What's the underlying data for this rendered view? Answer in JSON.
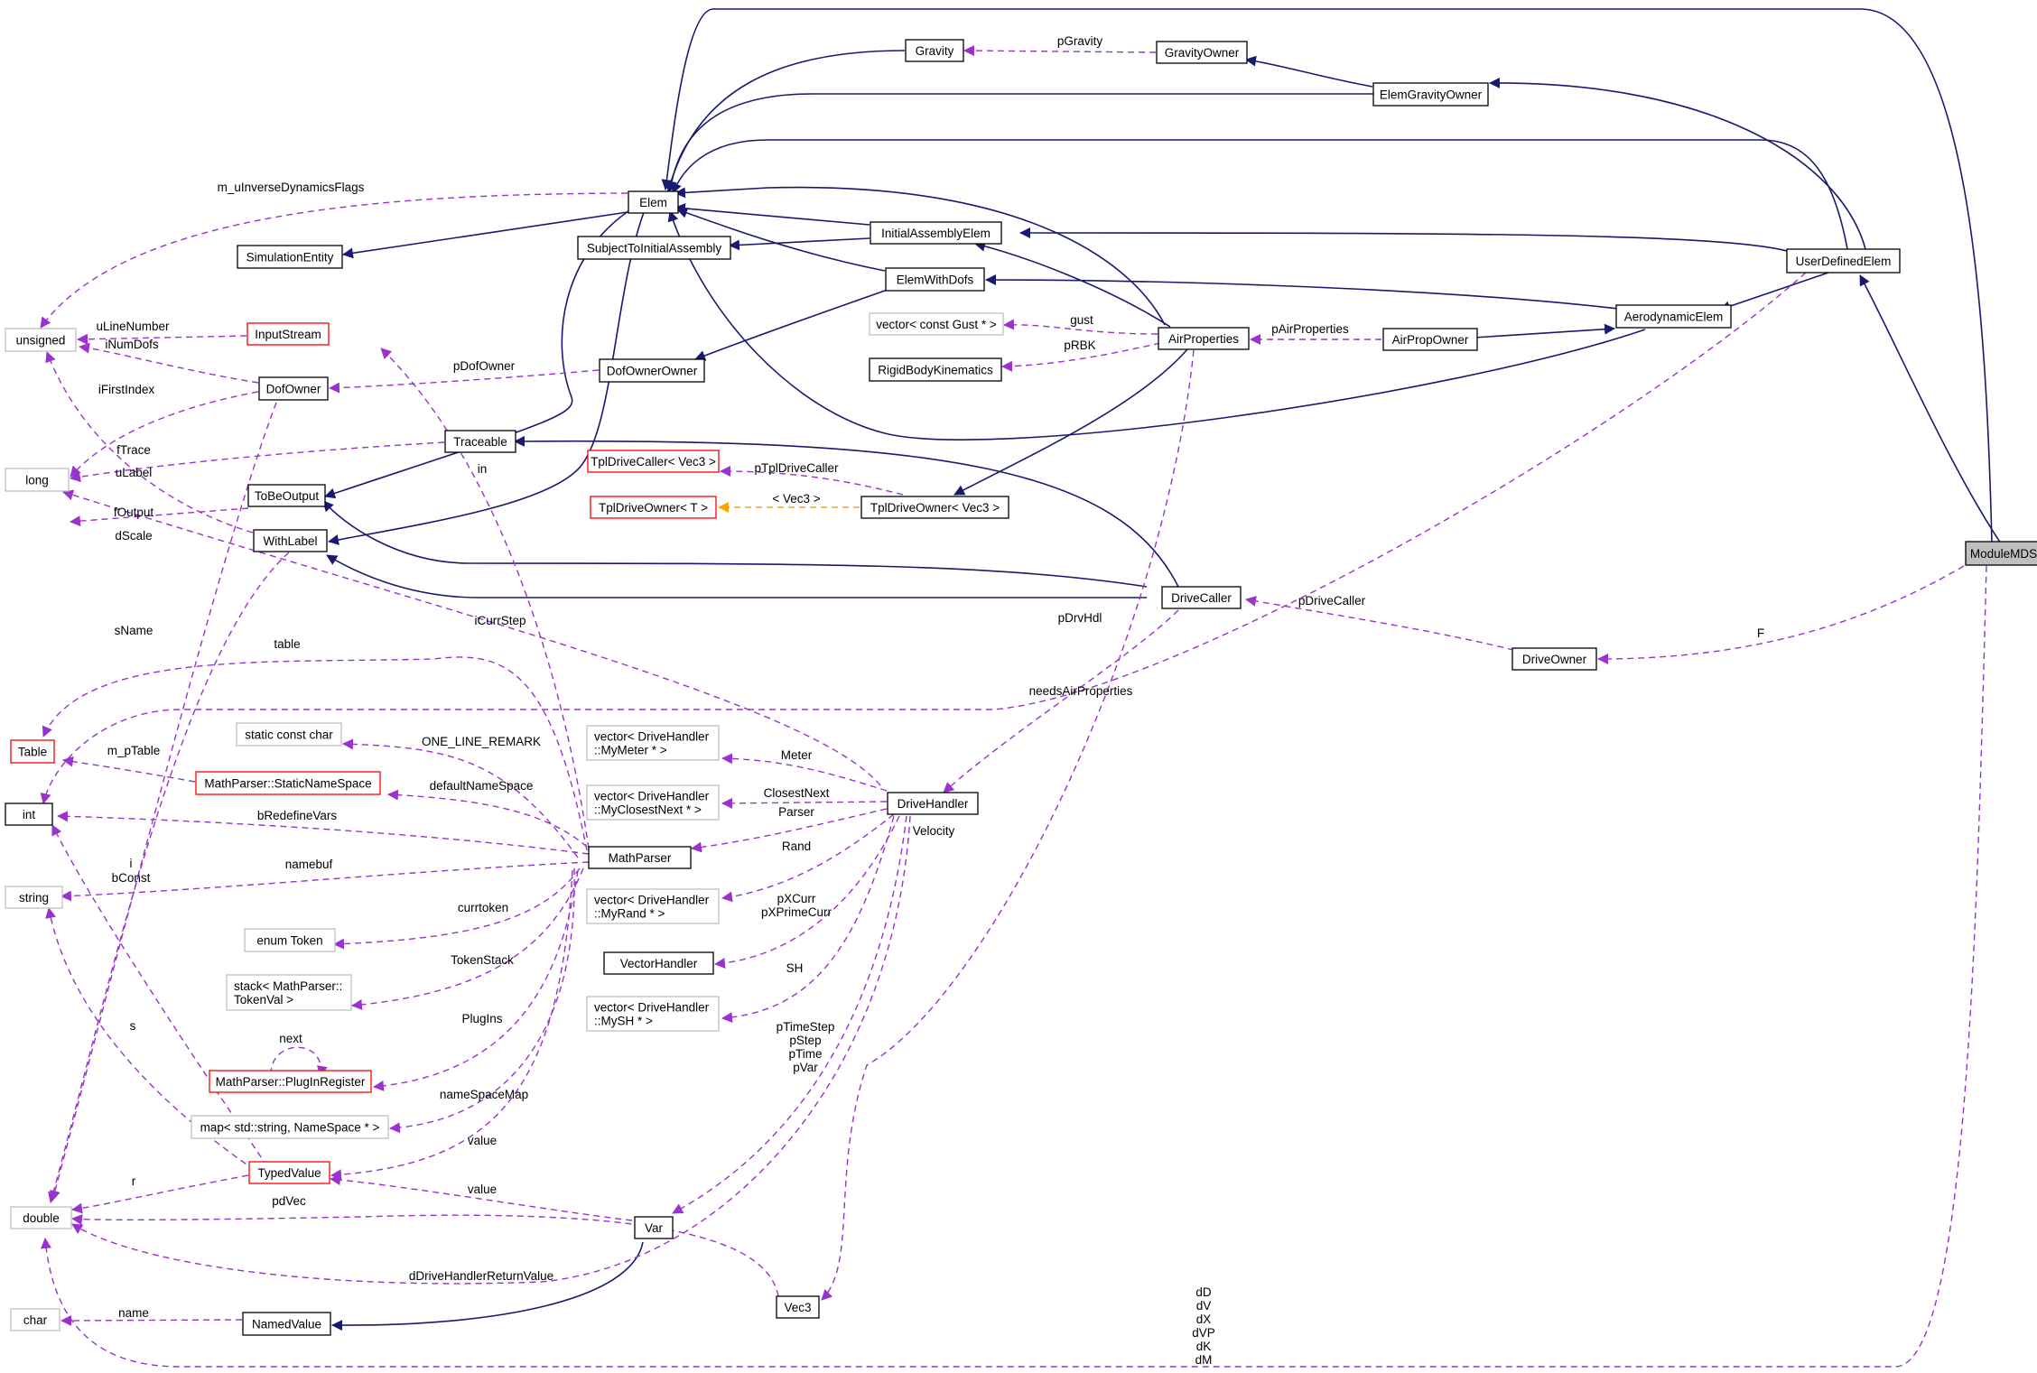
{
  "colors": {
    "inherit_edge": "#191970",
    "usage_edge": "#9a32cd",
    "template_edge": "#ffa500",
    "node_border_normal": "#000000",
    "node_border_truncated": "#ff0000",
    "node_border_external": "#bfbfbf",
    "root_fill": "#bfbfbf"
  },
  "nodes": [
    {
      "id": "ModuleMDS",
      "lines": [
        "ModuleMDS"
      ],
      "style": "root"
    },
    {
      "id": "UserDefinedElem",
      "lines": [
        "UserDefinedElem"
      ],
      "style": "normal"
    },
    {
      "id": "Elem",
      "lines": [
        "Elem"
      ],
      "style": "normal"
    },
    {
      "id": "Gravity",
      "lines": [
        "Gravity"
      ],
      "style": "normal"
    },
    {
      "id": "GravityOwner",
      "lines": [
        "GravityOwner"
      ],
      "style": "normal"
    },
    {
      "id": "ElemGravityOwner",
      "lines": [
        "ElemGravityOwner"
      ],
      "style": "normal"
    },
    {
      "id": "SimulationEntity",
      "lines": [
        "SimulationEntity"
      ],
      "style": "normal"
    },
    {
      "id": "SubjectToInitialAssembly",
      "lines": [
        "SubjectToInitialAssembly"
      ],
      "style": "normal"
    },
    {
      "id": "InitialAssemblyElem",
      "lines": [
        "InitialAssemblyElem"
      ],
      "style": "normal"
    },
    {
      "id": "ElemWithDofs",
      "lines": [
        "ElemWithDofs"
      ],
      "style": "normal"
    },
    {
      "id": "AerodynamicElem",
      "lines": [
        "AerodynamicElem"
      ],
      "style": "normal"
    },
    {
      "id": "unsigned",
      "lines": [
        "unsigned"
      ],
      "style": "external"
    },
    {
      "id": "InputStream",
      "lines": [
        "InputStream"
      ],
      "style": "truncated"
    },
    {
      "id": "DofOwner",
      "lines": [
        "DofOwner"
      ],
      "style": "normal"
    },
    {
      "id": "DofOwnerOwner",
      "lines": [
        "DofOwnerOwner"
      ],
      "style": "normal"
    },
    {
      "id": "vectorGust",
      "lines": [
        "vector< const Gust * >"
      ],
      "style": "external"
    },
    {
      "id": "AirProperties",
      "lines": [
        "AirProperties"
      ],
      "style": "normal"
    },
    {
      "id": "AirPropOwner",
      "lines": [
        "AirPropOwner"
      ],
      "style": "normal"
    },
    {
      "id": "RigidBodyKinematics",
      "lines": [
        "RigidBodyKinematics"
      ],
      "style": "normal"
    },
    {
      "id": "long",
      "lines": [
        "long"
      ],
      "style": "external"
    },
    {
      "id": "Traceable",
      "lines": [
        "Traceable"
      ],
      "style": "normal"
    },
    {
      "id": "TplDriveCallerVec3",
      "lines": [
        "TplDriveCaller< Vec3 >"
      ],
      "style": "truncated"
    },
    {
      "id": "ToBeOutput",
      "lines": [
        "ToBeOutput"
      ],
      "style": "normal"
    },
    {
      "id": "TplDriveOwnerT",
      "lines": [
        "TplDriveOwner< T >"
      ],
      "style": "truncated"
    },
    {
      "id": "TplDriveOwnerVec3",
      "lines": [
        "TplDriveOwner< Vec3 >"
      ],
      "style": "normal"
    },
    {
      "id": "WithLabel",
      "lines": [
        "WithLabel"
      ],
      "style": "normal"
    },
    {
      "id": "DriveCaller",
      "lines": [
        "DriveCaller"
      ],
      "style": "normal"
    },
    {
      "id": "DriveOwner",
      "lines": [
        "DriveOwner"
      ],
      "style": "normal"
    },
    {
      "id": "Table",
      "lines": [
        "Table"
      ],
      "style": "truncated"
    },
    {
      "id": "staticConstChar",
      "lines": [
        "static const char"
      ],
      "style": "external"
    },
    {
      "id": "StaticNameSpace",
      "lines": [
        "MathParser::StaticNameSpace"
      ],
      "style": "truncated"
    },
    {
      "id": "int",
      "lines": [
        "int"
      ],
      "style": "normal"
    },
    {
      "id": "vecMyMeter",
      "lines": [
        "vector< DriveHandler",
        "::MyMeter * >"
      ],
      "style": "external"
    },
    {
      "id": "vecMyClosestNext",
      "lines": [
        "vector< DriveHandler",
        "::MyClosestNext * >"
      ],
      "style": "external"
    },
    {
      "id": "DriveHandler",
      "lines": [
        "DriveHandler"
      ],
      "style": "normal"
    },
    {
      "id": "MathParser",
      "lines": [
        "MathParser"
      ],
      "style": "normal"
    },
    {
      "id": "string",
      "lines": [
        "string"
      ],
      "style": "external"
    },
    {
      "id": "enumToken",
      "lines": [
        "enum Token"
      ],
      "style": "external"
    },
    {
      "id": "vecMyRand",
      "lines": [
        "vector< DriveHandler",
        "::MyRand * >"
      ],
      "style": "external"
    },
    {
      "id": "VectorHandler",
      "lines": [
        "VectorHandler"
      ],
      "style": "normal"
    },
    {
      "id": "stackTokenVal",
      "lines": [
        "stack< MathParser::",
        "TokenVal >"
      ],
      "style": "external"
    },
    {
      "id": "vecMySH",
      "lines": [
        "vector< DriveHandler",
        "::MySH * >"
      ],
      "style": "external"
    },
    {
      "id": "PlugInRegister",
      "lines": [
        "MathParser::PlugInRegister"
      ],
      "style": "truncated"
    },
    {
      "id": "mapNameSpace",
      "lines": [
        "map< std::string, NameSpace * >"
      ],
      "style": "external"
    },
    {
      "id": "TypedValue",
      "lines": [
        "TypedValue"
      ],
      "style": "truncated"
    },
    {
      "id": "double",
      "lines": [
        "double"
      ],
      "style": "external"
    },
    {
      "id": "Var",
      "lines": [
        "Var"
      ],
      "style": "normal"
    },
    {
      "id": "Vec3",
      "lines": [
        "Vec3"
      ],
      "style": "normal"
    },
    {
      "id": "char",
      "lines": [
        "char"
      ],
      "style": "external"
    },
    {
      "id": "NamedValue",
      "lines": [
        "NamedValue"
      ],
      "style": "normal"
    }
  ],
  "edge_labels": [
    "pGravity",
    "m_uInverseDynamicsFlags",
    "gust",
    "pAirProperties",
    "pRBK",
    "uLineNumber",
    "iNumDofs",
    "pDofOwner",
    "iFirstIndex",
    "fTrace",
    "uLabel",
    "in",
    "pTplDriveCaller",
    "< Vec3 >",
    "fOutput",
    "dScale",
    "pDriveCaller",
    "F",
    "iCurrStep",
    "pDrvHdl",
    "sName",
    "table",
    "needsAirProperties",
    "ONE_LINE_REMARK",
    "m_pTable",
    "Meter",
    "defaultNameSpace",
    "ClosestNext",
    "Parser",
    "bRedefineVars",
    "Velocity",
    "namebuf",
    "i",
    "bConst",
    "Rand",
    "currtoken",
    "pXCurr",
    "pXPrimeCurr",
    "TokenStack",
    "SH",
    "PlugIns",
    "s",
    "next",
    "pTimeStep",
    "pStep",
    "pTime",
    "pVar",
    "nameSpaceMap",
    "value",
    "r",
    "value",
    "pdVec",
    "dDriveHandlerReturnValue",
    "name",
    "dD",
    "dV",
    "dX",
    "dVP",
    "dK",
    "dM"
  ]
}
